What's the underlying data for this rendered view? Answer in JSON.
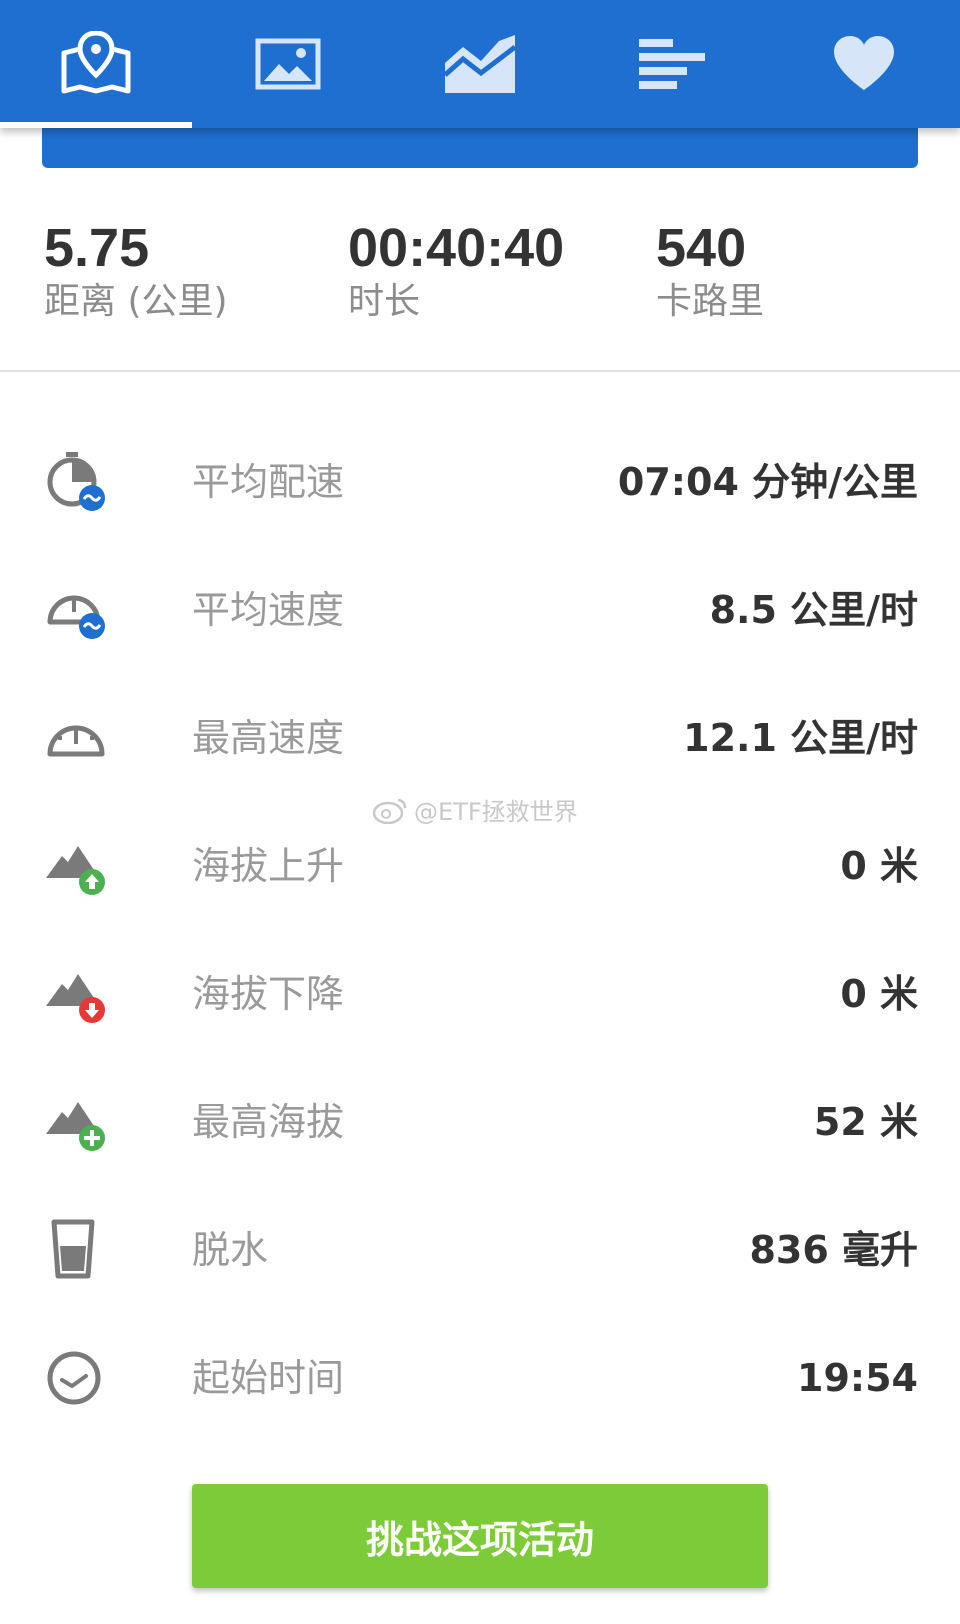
{
  "colors": {
    "primary": "#1e6fd0",
    "cta": "#7dcb38",
    "value_text": "#333333",
    "label_text": "#9a9a9a"
  },
  "tabs": [
    {
      "icon": "map-pin-icon",
      "active": true
    },
    {
      "icon": "photo-icon",
      "active": false
    },
    {
      "icon": "chart-icon",
      "active": false
    },
    {
      "icon": "splits-icon",
      "active": false
    },
    {
      "icon": "heart-icon",
      "active": false
    }
  ],
  "summary": {
    "distance": {
      "value": "5.75",
      "label": "距离 (公里)"
    },
    "duration": {
      "value": "00:40:40",
      "label": "时长"
    },
    "calories": {
      "value": "540",
      "label": "卡路里"
    }
  },
  "stats": [
    {
      "icon": "avg-pace-icon",
      "label": "平均配速",
      "value": "07:04 分钟/公里"
    },
    {
      "icon": "avg-speed-icon",
      "label": "平均速度",
      "value": "8.5 公里/时"
    },
    {
      "icon": "max-speed-icon",
      "label": "最高速度",
      "value": "12.1 公里/时"
    },
    {
      "icon": "elevation-gain-icon",
      "label": "海拔上升",
      "value": "0 米"
    },
    {
      "icon": "elevation-loss-icon",
      "label": "海拔下降",
      "value": "0 米"
    },
    {
      "icon": "max-elevation-icon",
      "label": "最高海拔",
      "value": "52 米"
    },
    {
      "icon": "dehydration-icon",
      "label": "脱水",
      "value": "836 毫升"
    },
    {
      "icon": "start-time-icon",
      "label": "起始时间",
      "value": "19:54"
    }
  ],
  "watermark": "@ETF拯救世界",
  "cta_label": "挑战这项活动"
}
